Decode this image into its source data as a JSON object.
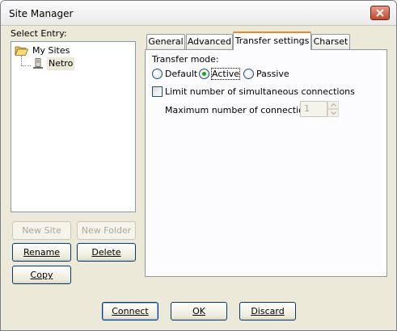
{
  "window": {
    "title": "Site Manager"
  },
  "left": {
    "select_entry_label": "Select Entry:",
    "tree": {
      "root": "My Sites",
      "child": "Netro"
    },
    "buttons": {
      "new_site": "New Site",
      "new_folder": "New Folder",
      "rename": "Rename",
      "delete": "Delete",
      "copy": "Copy"
    }
  },
  "tabs": [
    "General",
    "Advanced",
    "Transfer settings",
    "Charset"
  ],
  "active_tab": "Transfer settings",
  "transfer": {
    "mode_label": "Transfer mode:",
    "modes": [
      "Default",
      "Active",
      "Passive"
    ],
    "selected_mode": "Active",
    "limit_label": "Limit number of simultaneous connections",
    "limit_checked": false,
    "max_label": "Maximum number of connections:",
    "max_value": "1"
  },
  "footer": {
    "connect": "Connect",
    "ok": "OK",
    "discard": "Discard"
  }
}
